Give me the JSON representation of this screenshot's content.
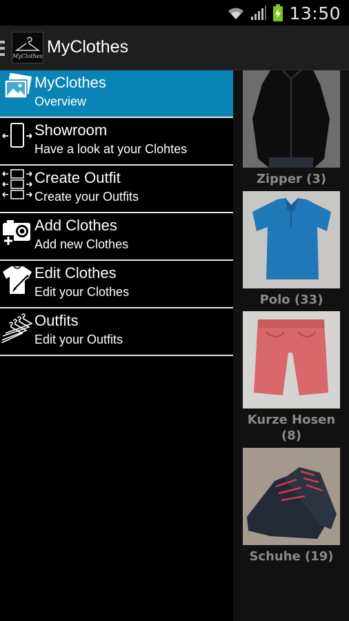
{
  "status_bar": {
    "time": "13:50",
    "icons": [
      "wifi-icon",
      "signal-icon",
      "battery-charging-icon"
    ]
  },
  "action_bar": {
    "title": "MyClothes",
    "logo_text": "MyClothes"
  },
  "drawer": {
    "items": [
      {
        "title": "MyClothes",
        "subtitle": "Overview",
        "icon": "pictures-icon",
        "selected": true
      },
      {
        "title": "Showroom",
        "subtitle": "Have a look at your Clohtes",
        "icon": "phone-swipe-icon",
        "selected": false
      },
      {
        "title": "Create Outfit",
        "subtitle": "Create your Outfits",
        "icon": "outfit-builder-icon",
        "selected": false
      },
      {
        "title": "Add Clothes",
        "subtitle": "Add new Clothes",
        "icon": "add-camera-icon",
        "selected": false
      },
      {
        "title": "Edit Clothes",
        "subtitle": "Edit your Clothes",
        "icon": "shirt-edit-icon",
        "selected": false
      },
      {
        "title": "Outfits",
        "subtitle": "Edit your Outfits",
        "icon": "hangers-icon",
        "selected": false
      }
    ]
  },
  "categories": [
    {
      "label": "Zipper (3)"
    },
    {
      "label": "Polo (33)"
    },
    {
      "label": "Kurze Hosen (8)"
    },
    {
      "label": "Schuhe (19)"
    }
  ],
  "colors": {
    "accent": "#0a83b5",
    "action_bar": "#1e1e1e",
    "category_label": "#8a8a8a"
  }
}
